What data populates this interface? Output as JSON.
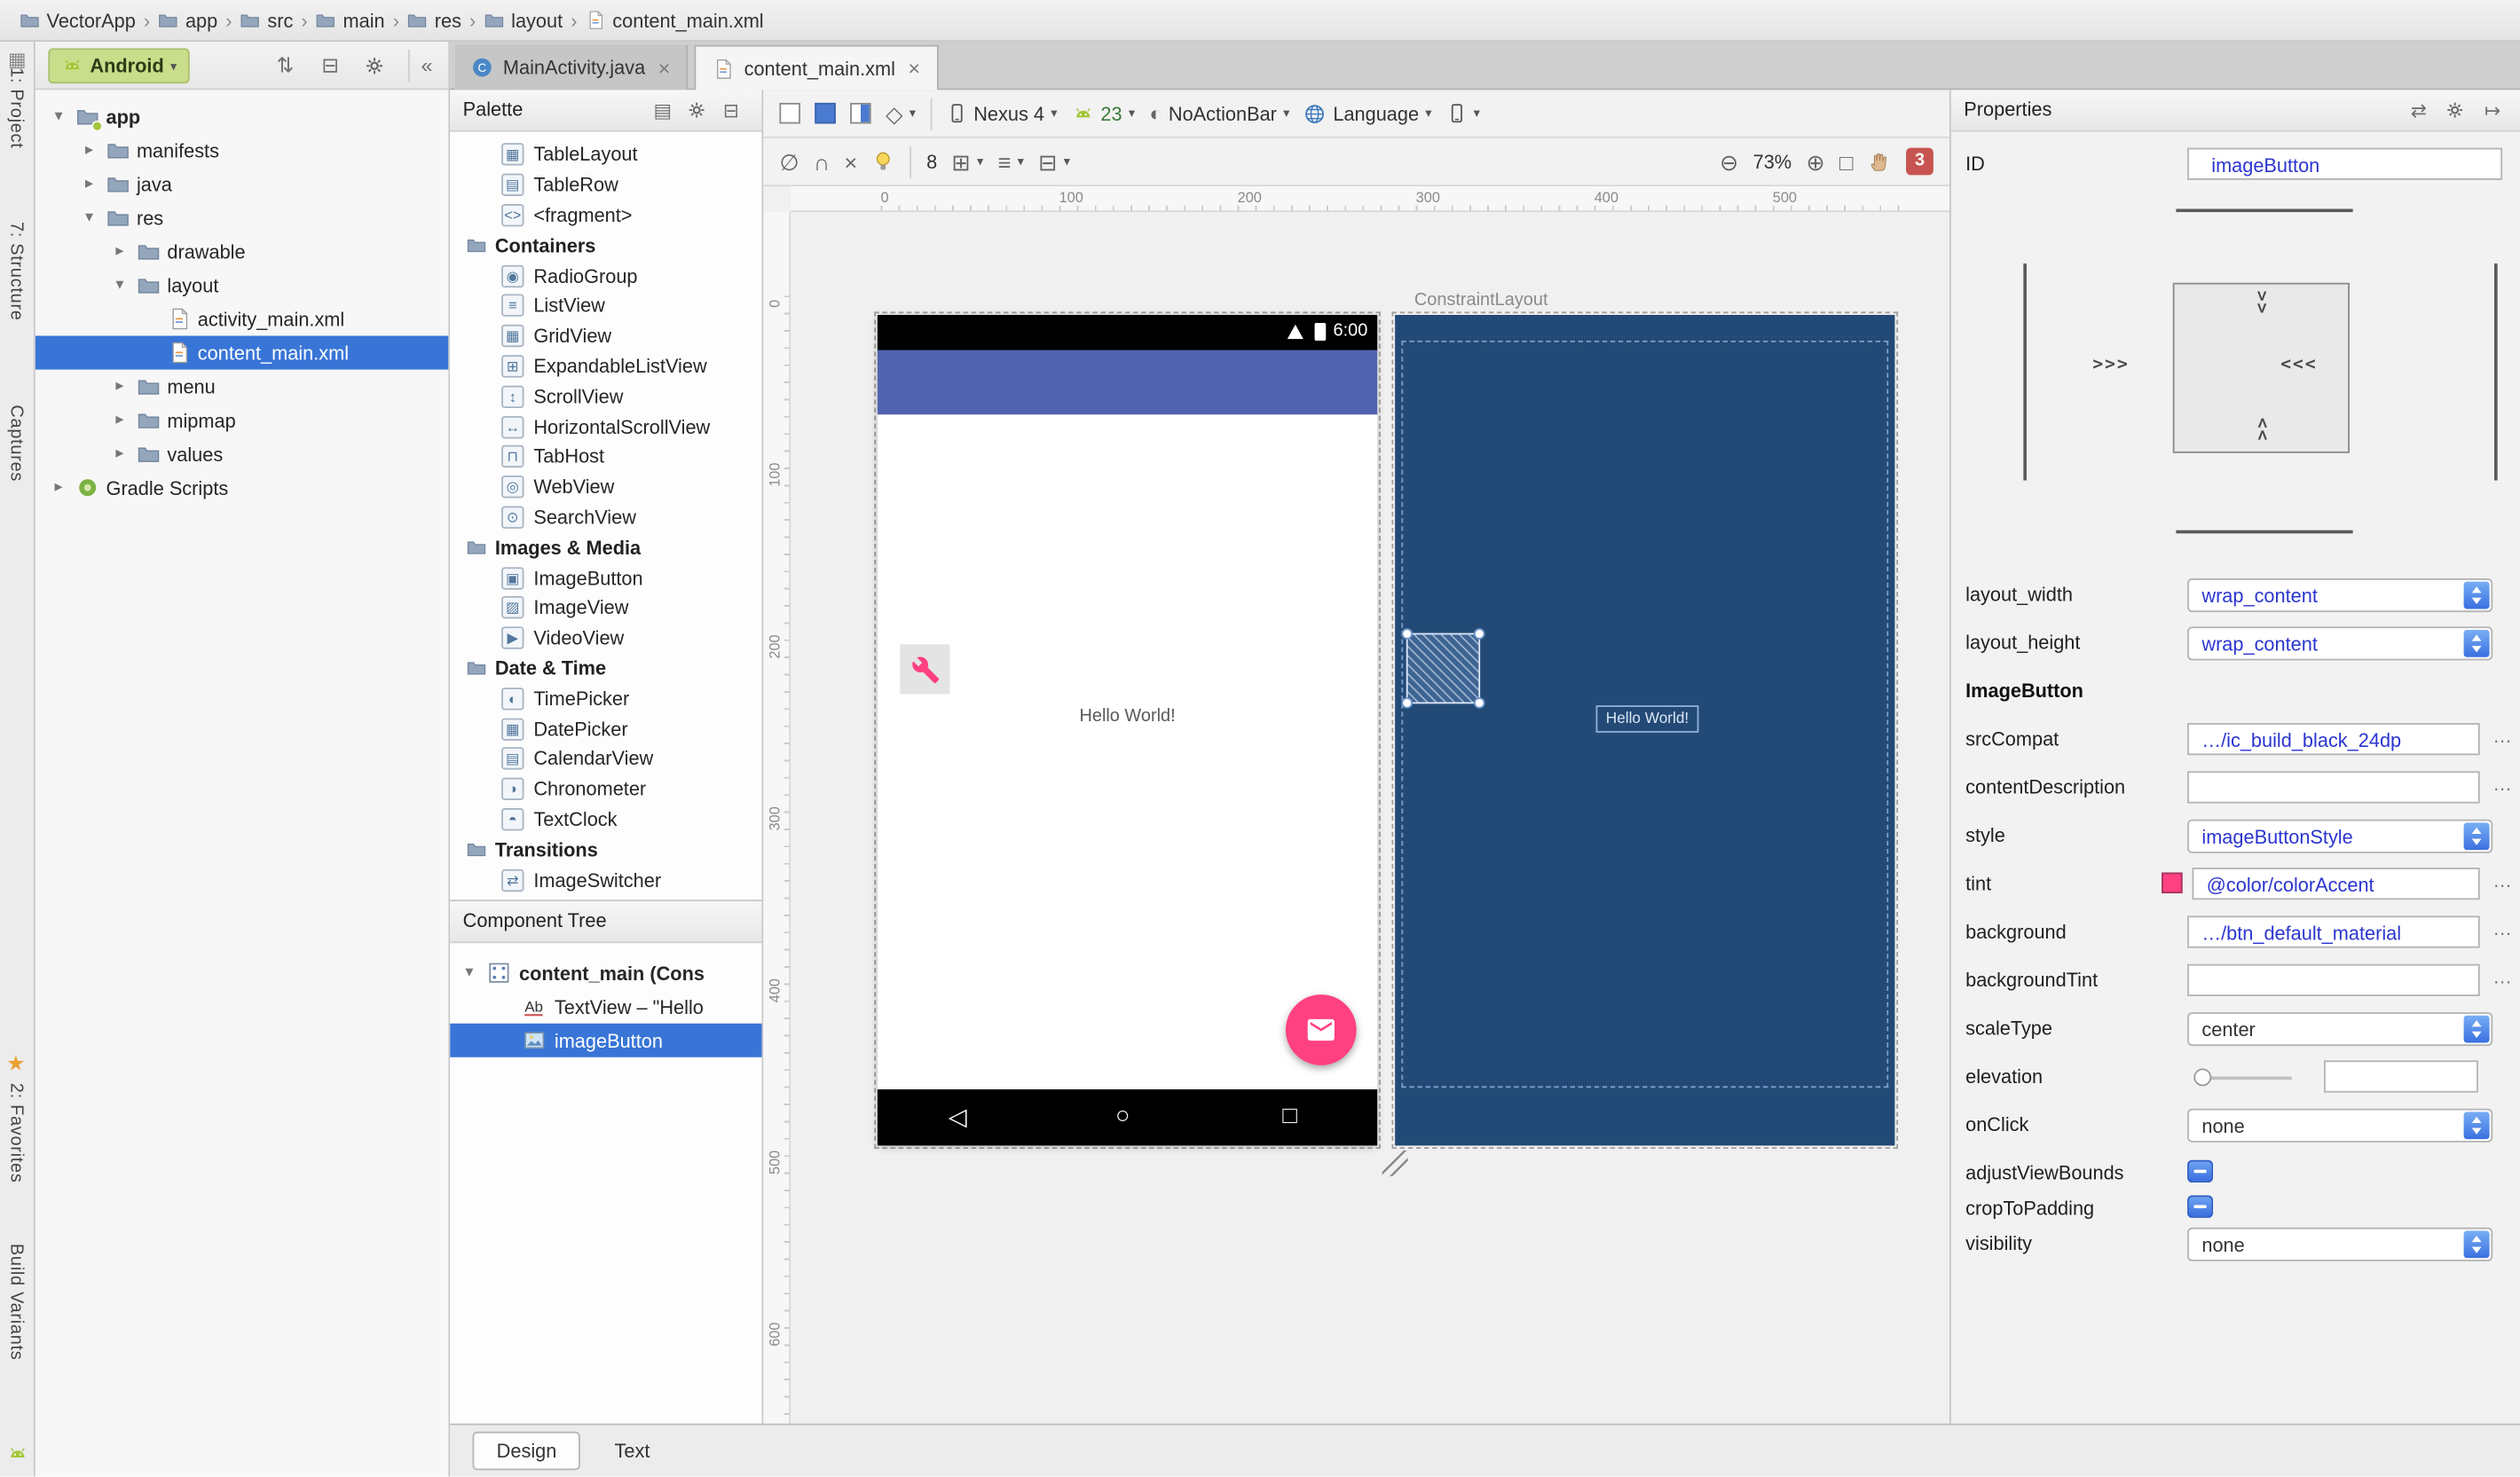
{
  "window": {
    "breadcrumb": [
      "VectorApp",
      "app",
      "src",
      "main",
      "res",
      "layout",
      "content_main.xml"
    ]
  },
  "edge_strip": {
    "top": [
      "1: Project",
      "7: Structure",
      "Captures"
    ],
    "bottom": [
      "2: Favorites",
      "Build Variants"
    ]
  },
  "project_panel": {
    "selector_label": "Android",
    "tree": [
      {
        "label": "app",
        "depth": 0,
        "arrow": "down",
        "icon": "folder-app",
        "bold": true
      },
      {
        "label": "manifests",
        "depth": 1,
        "arrow": "right",
        "icon": "folder"
      },
      {
        "label": "java",
        "depth": 1,
        "arrow": "right",
        "icon": "folder"
      },
      {
        "label": "res",
        "depth": 1,
        "arrow": "down",
        "icon": "folder"
      },
      {
        "label": "drawable",
        "depth": 2,
        "arrow": "right",
        "icon": "folder"
      },
      {
        "label": "layout",
        "depth": 2,
        "arrow": "down",
        "icon": "folder"
      },
      {
        "label": "activity_main.xml",
        "depth": 3,
        "icon": "xml"
      },
      {
        "label": "content_main.xml",
        "depth": 3,
        "icon": "xml",
        "selected": true
      },
      {
        "label": "menu",
        "depth": 2,
        "arrow": "right",
        "icon": "folder"
      },
      {
        "label": "mipmap",
        "depth": 2,
        "arrow": "right",
        "icon": "folder"
      },
      {
        "label": "values",
        "depth": 2,
        "arrow": "right",
        "icon": "folder"
      },
      {
        "label": "Gradle Scripts",
        "depth": 0,
        "arrow": "right",
        "icon": "gradle"
      }
    ]
  },
  "editor_tabs": [
    {
      "label": "MainActivity.java",
      "active": false
    },
    {
      "label": "content_main.xml",
      "active": true
    }
  ],
  "palette": {
    "title": "Palette",
    "rows": [
      {
        "t": "item",
        "label": "TableLayout",
        "icon": "table-layout"
      },
      {
        "t": "item",
        "label": "TableRow",
        "icon": "table-row"
      },
      {
        "t": "item",
        "label": "<fragment>",
        "icon": "fragment"
      },
      {
        "t": "header",
        "label": "Containers"
      },
      {
        "t": "item",
        "label": "RadioGroup",
        "icon": "radio-group"
      },
      {
        "t": "item",
        "label": "ListView",
        "icon": "list-view"
      },
      {
        "t": "item",
        "label": "GridView",
        "icon": "grid-view"
      },
      {
        "t": "item",
        "label": "ExpandableListView",
        "icon": "expandable-list-view"
      },
      {
        "t": "item",
        "label": "ScrollView",
        "icon": "scroll-view"
      },
      {
        "t": "item",
        "label": "HorizontalScrollView",
        "icon": "horizontal-scroll-view"
      },
      {
        "t": "item",
        "label": "TabHost",
        "icon": "tab-host"
      },
      {
        "t": "item",
        "label": "WebView",
        "icon": "web-view"
      },
      {
        "t": "item",
        "label": "SearchView",
        "icon": "search-view"
      },
      {
        "t": "header",
        "label": "Images & Media"
      },
      {
        "t": "item",
        "label": "ImageButton",
        "icon": "image-button"
      },
      {
        "t": "item",
        "label": "ImageView",
        "icon": "image-view"
      },
      {
        "t": "item",
        "label": "VideoView",
        "icon": "video-view"
      },
      {
        "t": "header",
        "label": "Date & Time"
      },
      {
        "t": "item",
        "label": "TimePicker",
        "icon": "time-picker"
      },
      {
        "t": "item",
        "label": "DatePicker",
        "icon": "date-picker"
      },
      {
        "t": "item",
        "label": "CalendarView",
        "icon": "calendar-view"
      },
      {
        "t": "item",
        "label": "Chronometer",
        "icon": "chronometer"
      },
      {
        "t": "item",
        "label": "TextClock",
        "icon": "text-clock"
      },
      {
        "t": "header",
        "label": "Transitions"
      },
      {
        "t": "item",
        "label": "ImageSwitcher",
        "icon": "image-switcher"
      }
    ]
  },
  "component_tree": {
    "title": "Component Tree",
    "rows": [
      {
        "label": "content_main (Cons",
        "icon": "constraint-layout",
        "bold": true,
        "arrow": "down"
      },
      {
        "label": "TextView – \"Hello",
        "icon": "text-view",
        "indent": 1
      },
      {
        "label": "imageButton",
        "icon": "image-view",
        "indent": 1,
        "selected": true
      }
    ]
  },
  "design_toolbar": {
    "device": "Nexus 4",
    "api_level": "23",
    "theme": "NoActionBar",
    "locale": "Language",
    "default_margin": "8",
    "zoom": "73%",
    "error_count": "3"
  },
  "canvas": {
    "blueprint_label": "ConstraintLayout",
    "status_time": "6:00",
    "hello_design": "Hello World!",
    "hello_blueprint": "Hello World!",
    "top_ruler": [
      "0",
      "100",
      "200",
      "300",
      "400",
      "500"
    ],
    "left_ruler": [
      "0",
      "100",
      "200",
      "300",
      "400",
      "500",
      "600"
    ]
  },
  "properties": {
    "title": "Properties",
    "id_label": "ID",
    "id_value": "imageButton",
    "rows": [
      {
        "label": "layout_width",
        "type": "dropdown",
        "value": "wrap_content"
      },
      {
        "label": "layout_height",
        "type": "dropdown",
        "value": "wrap_content"
      },
      {
        "label": "ImageButton",
        "type": "section"
      },
      {
        "label": "srcCompat",
        "type": "text",
        "value": "…/ic_build_black_24dp"
      },
      {
        "label": "contentDescription",
        "type": "text",
        "value": ""
      },
      {
        "label": "style",
        "type": "dropdown",
        "value": "imageButtonStyle"
      },
      {
        "label": "tint",
        "type": "color",
        "value": "@color/colorAccent",
        "swatch": "#FF4081"
      },
      {
        "label": "background",
        "type": "text",
        "value": "…/btn_default_material"
      },
      {
        "label": "backgroundTint",
        "type": "text",
        "value": ""
      },
      {
        "label": "scaleType",
        "type": "dropdown",
        "value": "center",
        "plain": true
      },
      {
        "label": "elevation",
        "type": "slider",
        "value": ""
      },
      {
        "label": "onClick",
        "type": "dropdown",
        "value": "none",
        "plain": true
      },
      {
        "label": "adjustViewBounds",
        "type": "toggle"
      },
      {
        "label": "cropToPadding",
        "type": "toggle"
      },
      {
        "label": "visibility",
        "type": "dropdown",
        "value": "none",
        "plain": true
      }
    ]
  },
  "bottom_tabs": [
    {
      "label": "Design",
      "active": true
    },
    {
      "label": "Text",
      "active": false
    }
  ],
  "colors": {
    "accent": "#FF4081",
    "primary": "#5163B0",
    "blueprint_bg": "#234A76",
    "selection": "#3875D7"
  }
}
